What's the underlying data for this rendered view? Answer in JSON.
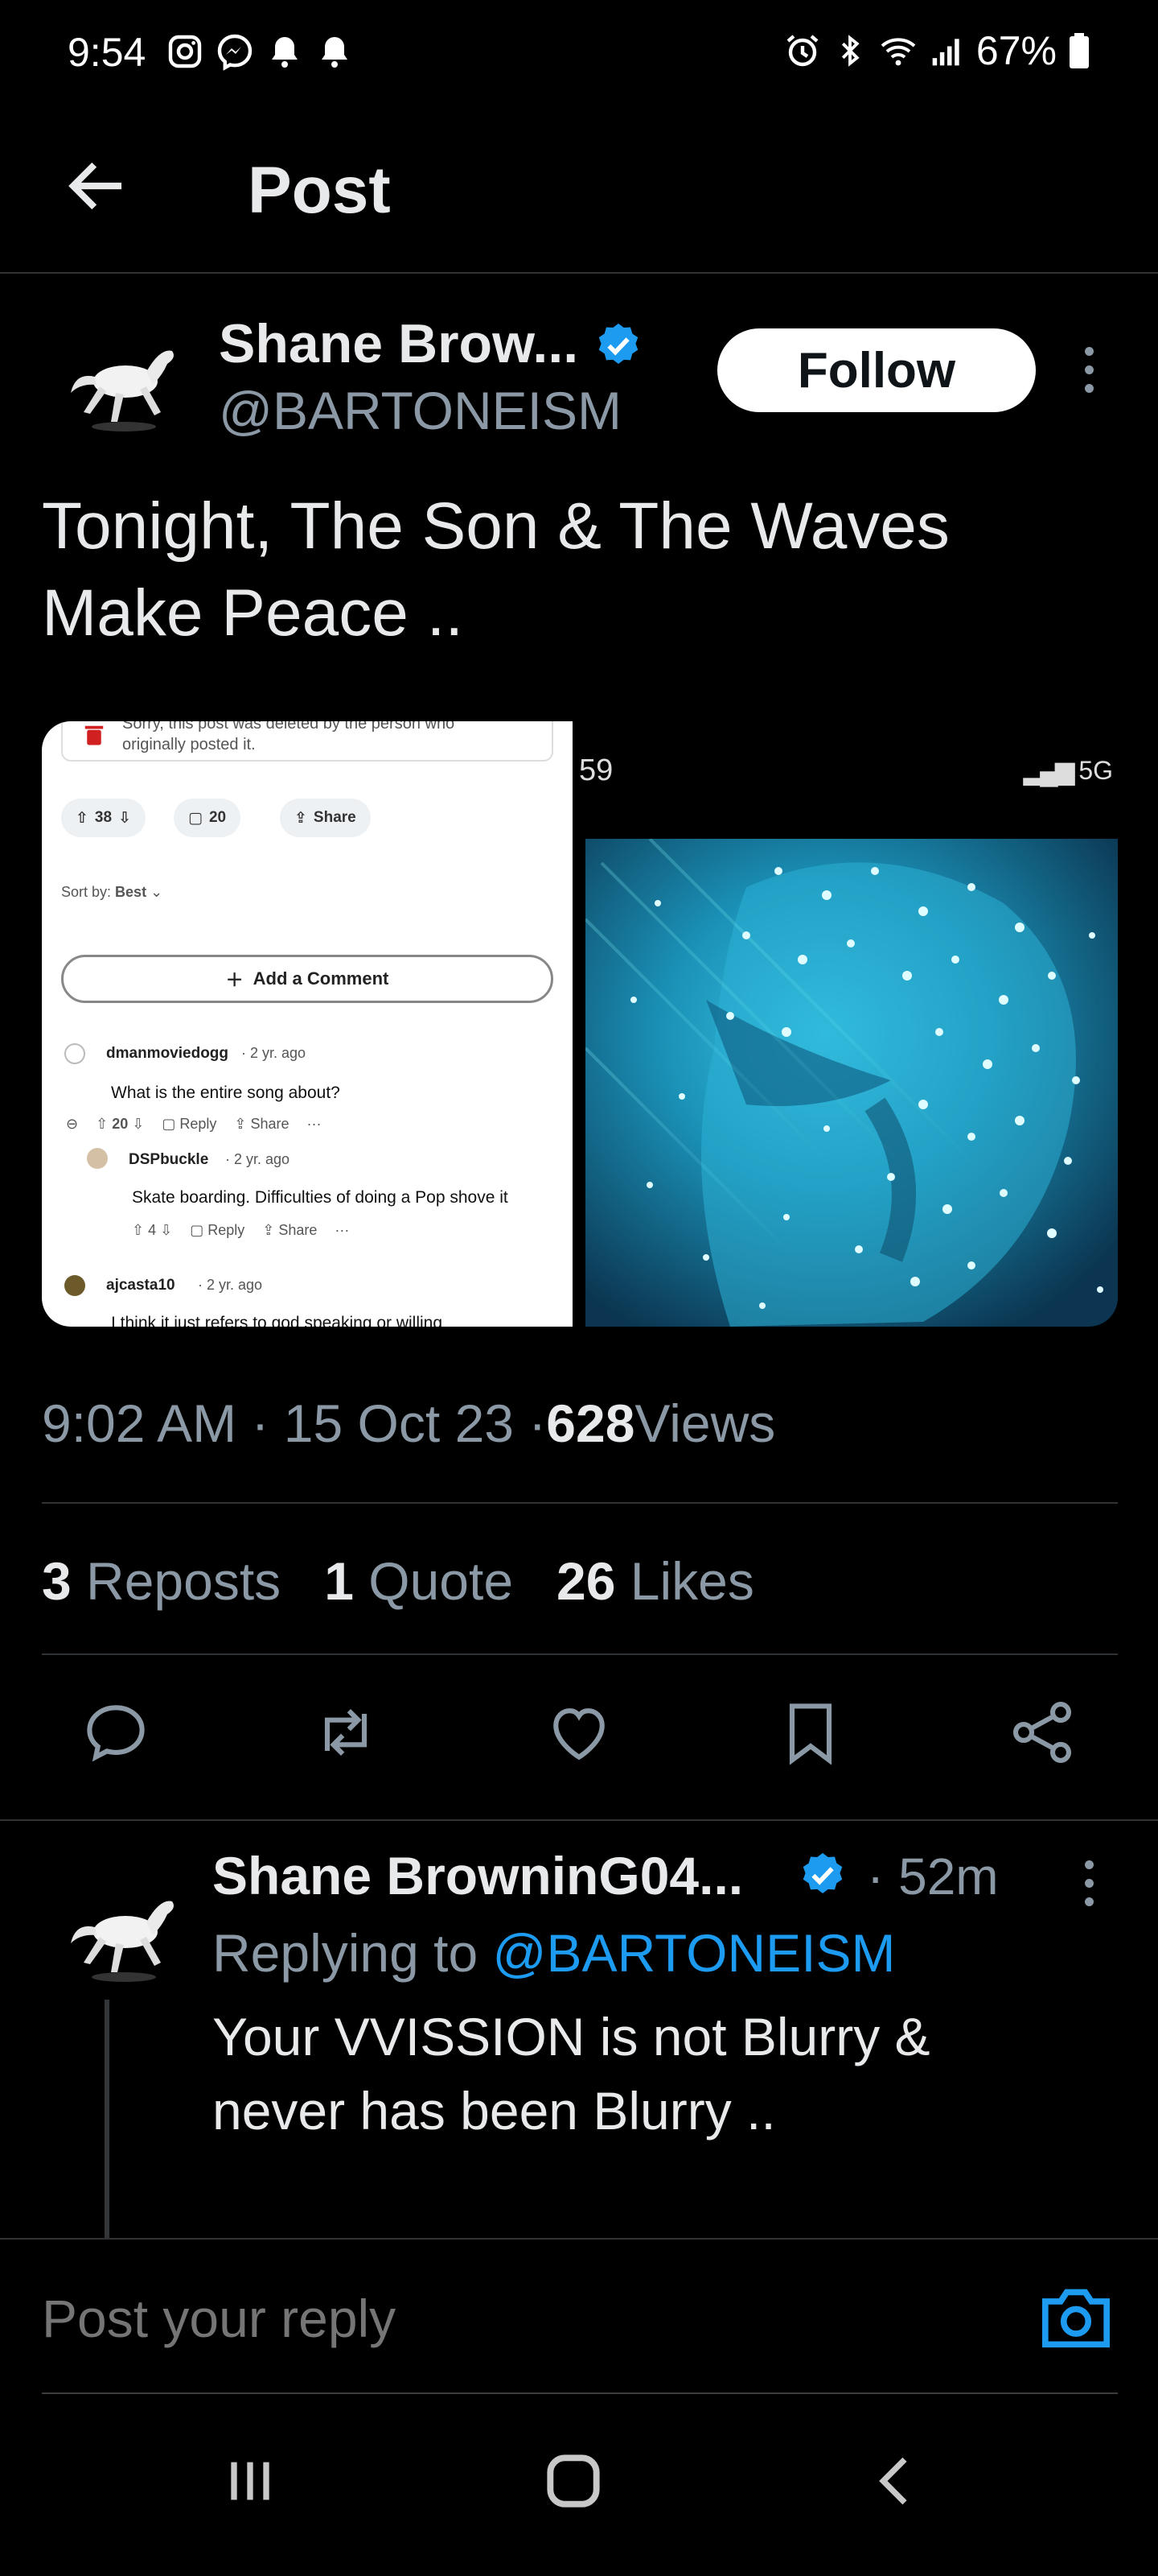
{
  "status_bar": {
    "time": "9:54",
    "battery": "67%",
    "icons_left": [
      "instagram-icon",
      "messenger-icon",
      "bell-icon",
      "bell-icon"
    ],
    "icons_right": [
      "alarm-icon",
      "bluetooth-icon",
      "wifi-icon",
      "signal-icon",
      "battery-icon"
    ]
  },
  "header": {
    "title": "Post"
  },
  "post": {
    "author_name": "Shane Brow...",
    "author_handle": "@BARTONEISM",
    "follow_label": "Follow",
    "text_line1": "Tonight, The Son & The Waves",
    "text_line2": "Make Peace ..",
    "timestamp": "9:02 AM · 15 Oct 23 · ",
    "views_count": "628",
    "views_label": " Views",
    "reposts_count": "3",
    "reposts_label": " Reposts",
    "quotes_count": "1",
    "quotes_label": " Quote",
    "likes_count": "26",
    "likes_label": " Likes"
  },
  "media_left": {
    "deleted_line1": "Sorry, this post was deleted by the person who",
    "deleted_line2": "originally posted it.",
    "votes": "38",
    "comments": "20",
    "share": "Share",
    "sort_label": "Sort by:",
    "sort_value": "Best",
    "add_comment": "Add a Comment",
    "c1_user": "dmanmoviedogg",
    "c1_time": "· 2 yr. ago",
    "c1_text": "What is the entire song about?",
    "c1_votes": "20",
    "reply": "Reply",
    "c2_user": "DSPbuckle",
    "c2_time": "· 2 yr. ago",
    "c2_text": "Skate boarding. Difficulties of doing a Pop shove it",
    "c2_votes": "4",
    "c3_user": "ajcasta10",
    "c3_time": "· 2 yr. ago",
    "c3_text": "I think it just refers to god speaking or willing"
  },
  "media_right": {
    "time": "59",
    "network": "5G"
  },
  "reply": {
    "author_name": "Shane BrowninG04...",
    "time": "· 52m",
    "replying_prefix": "Replying to ",
    "replying_handle": "@BARTONEISM",
    "text_line1": "Your VVISSION is not Blurry &",
    "text_line2": "never has been Blurry .."
  },
  "composer": {
    "placeholder": "Post your reply"
  },
  "colors": {
    "background": "#000000",
    "accent": "#1d9bf0",
    "secondary_text": "#8b98a5"
  }
}
